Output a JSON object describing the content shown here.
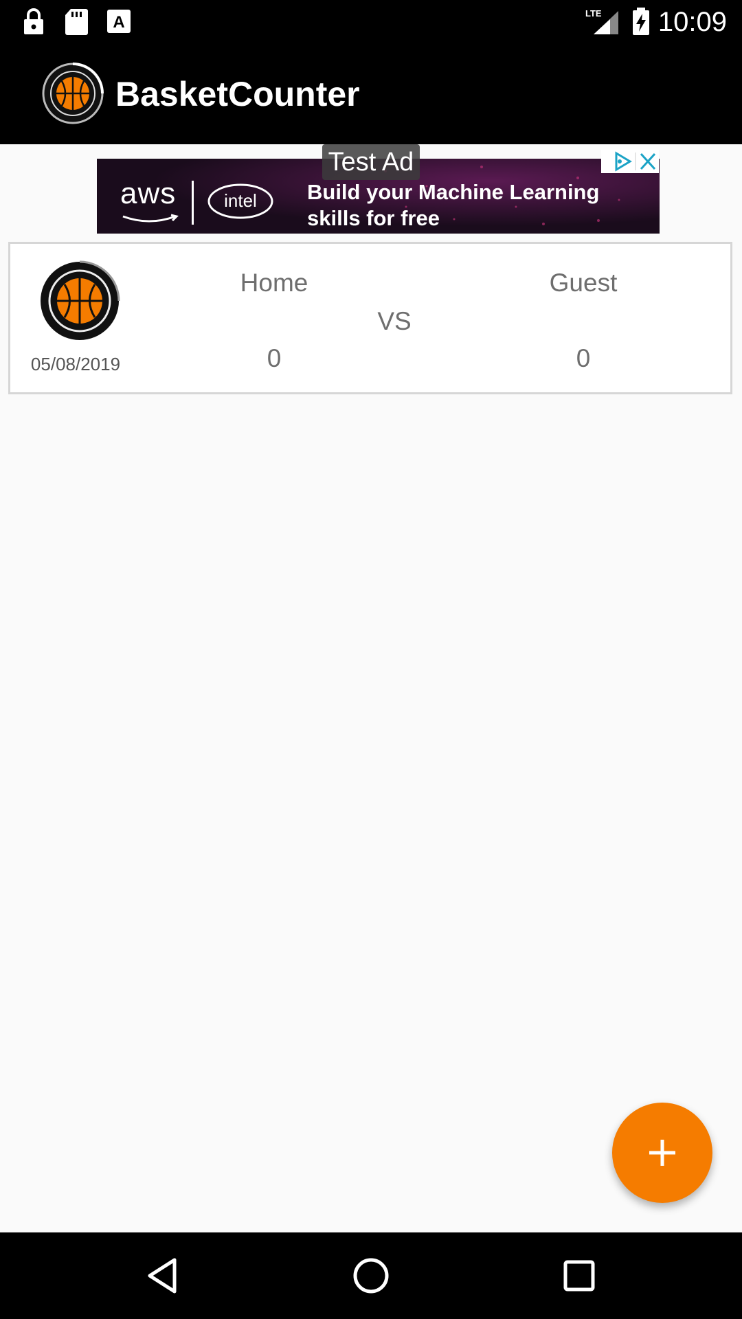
{
  "status_bar": {
    "time": "10:09",
    "network": "LTE",
    "icons": [
      "lock-icon",
      "sd-card-icon",
      "font-a-icon",
      "lte-signal-icon",
      "battery-charging-icon"
    ]
  },
  "app_bar": {
    "title": "BasketCounter",
    "logo": "basketball-logo-icon"
  },
  "ad": {
    "badge": "Test Ad",
    "brand_left": "aws",
    "brand_right": "intel",
    "text_line1": "Build your Machine Learning",
    "text_line2": "skills for free",
    "choices_icon": "adchoices-icon",
    "close_icon": "close-icon"
  },
  "games": [
    {
      "date": "05/08/2019",
      "home_label": "Home",
      "guest_label": "Guest",
      "vs_label": "VS",
      "home_score": "0",
      "guest_score": "0"
    }
  ],
  "fab": {
    "icon": "plus-icon"
  },
  "nav_bar": {
    "icons": [
      "back-icon",
      "home-icon",
      "recents-icon"
    ]
  },
  "colors": {
    "accent": "#f57c00",
    "app_bar": "#000000",
    "background": "#fafafa",
    "card_border": "#d6d6d6",
    "text_secondary": "#6e6e6e"
  }
}
